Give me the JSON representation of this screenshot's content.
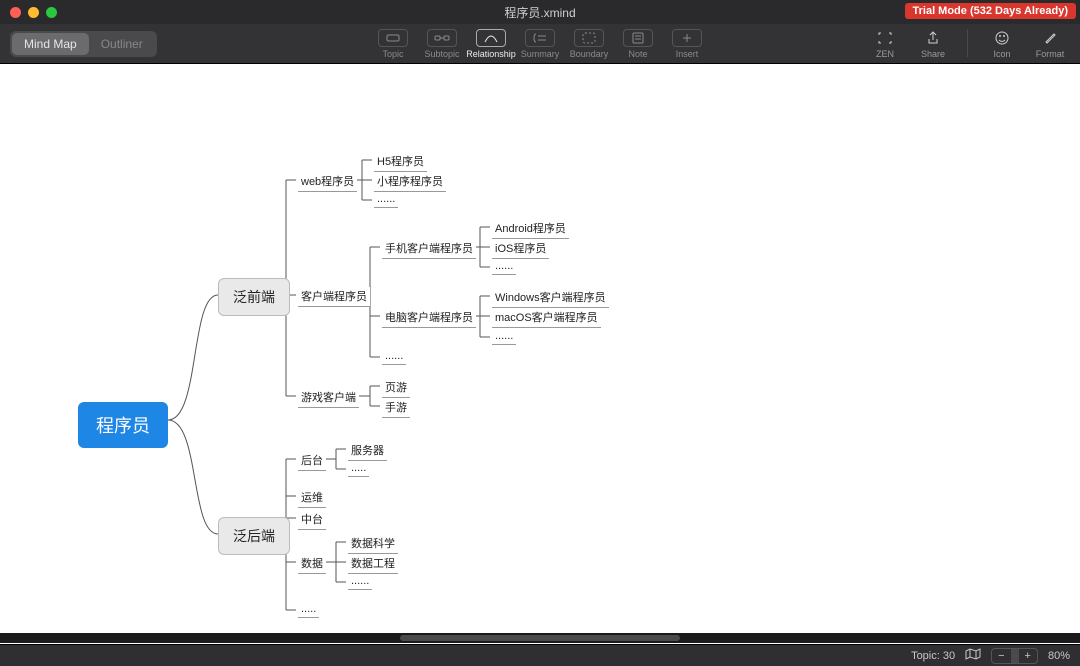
{
  "window": {
    "title": "程序员.xmind",
    "trial_badge": "Trial Mode (532 Days Already)"
  },
  "view_switch": {
    "mindmap": "Mind Map",
    "outliner": "Outliner"
  },
  "toolbar": {
    "topic": "Topic",
    "subtopic": "Subtopic",
    "relationship": "Relationship",
    "summary": "Summary",
    "boundary": "Boundary",
    "note": "Note",
    "insert": "Insert",
    "zen": "ZEN",
    "share": "Share",
    "icon": "Icon",
    "format": "Format"
  },
  "status": {
    "topic_count_label": "Topic: 30",
    "zoom_label": "80%"
  },
  "mindmap": {
    "root": "程序员",
    "branches": [
      {
        "label": "泛前端",
        "children": [
          {
            "label": "web程序员",
            "children": [
              {
                "label": "H5程序员"
              },
              {
                "label": "小程序程序员"
              },
              {
                "label": "......"
              }
            ]
          },
          {
            "label": "客户端程序员",
            "children": [
              {
                "label": "手机客户端程序员",
                "children": [
                  {
                    "label": "Android程序员"
                  },
                  {
                    "label": "iOS程序员"
                  },
                  {
                    "label": "......"
                  }
                ]
              },
              {
                "label": "电脑客户端程序员",
                "children": [
                  {
                    "label": "Windows客户端程序员"
                  },
                  {
                    "label": "macOS客户端程序员"
                  },
                  {
                    "label": "......"
                  }
                ]
              },
              {
                "label": "......"
              }
            ]
          },
          {
            "label": "游戏客户端",
            "children": [
              {
                "label": "页游"
              },
              {
                "label": "手游"
              }
            ]
          }
        ]
      },
      {
        "label": "泛后端",
        "children": [
          {
            "label": "后台",
            "children": [
              {
                "label": "服务器"
              },
              {
                "label": "....."
              }
            ]
          },
          {
            "label": "运维"
          },
          {
            "label": "中台"
          },
          {
            "label": "数据",
            "children": [
              {
                "label": "数据科学"
              },
              {
                "label": "数据工程"
              },
              {
                "label": "......"
              }
            ]
          },
          {
            "label": "....."
          }
        ]
      }
    ]
  }
}
